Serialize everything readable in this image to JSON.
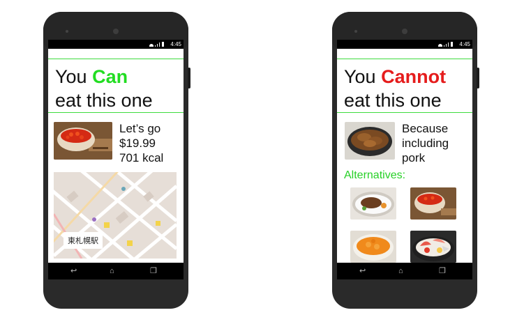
{
  "status_bar": {
    "time": "4:45"
  },
  "left_phone": {
    "title_prefix": "You ",
    "title_emphasis": "Can",
    "title_line2": "eat this one",
    "info_line1": "Let’s go",
    "info_line2": "$19.99",
    "info_line3": "701 kcal",
    "map_label": "東札幌駅",
    "emphasis_color": "#22dd22",
    "food_image": "salmon-roe-bowl"
  },
  "right_phone": {
    "title_prefix": "You ",
    "title_emphasis": "Cannot",
    "title_line2": "eat this one",
    "info_line1": "Because",
    "info_line2": "including",
    "info_line3": "pork",
    "alternatives_label": "Alternatives:",
    "emphasis_color": "#e51c1c",
    "food_image": "pork-rice-bowl",
    "alternatives": [
      "beef-plate",
      "salmon-roe-bowl",
      "uni-rice-bowl",
      "seafood-bowl"
    ]
  },
  "nav_icons": [
    "back-icon",
    "home-icon",
    "recents-icon"
  ]
}
